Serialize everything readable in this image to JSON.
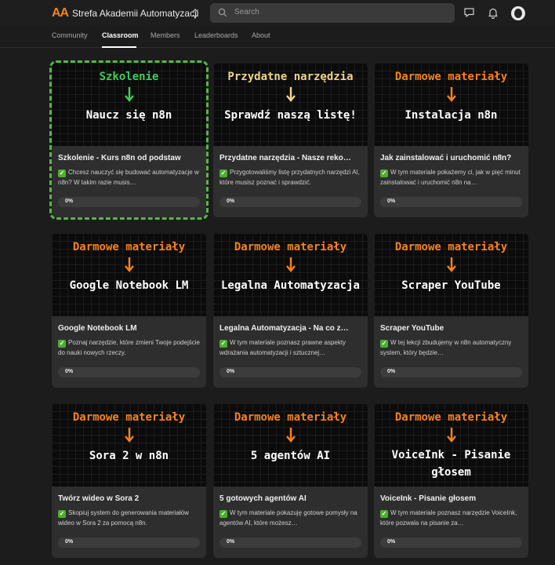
{
  "header": {
    "logo_text": "AA",
    "site_title": "Strefa Akademii Automatyzacji",
    "search_placeholder": "Search"
  },
  "tabs": [
    {
      "label": "Community"
    },
    {
      "label": "Classroom"
    },
    {
      "label": "Members"
    },
    {
      "label": "Leaderboards"
    },
    {
      "label": "About"
    }
  ],
  "colors": {
    "orange": "#f5821f",
    "yellow": "#f1d589",
    "green": "#3fcf55",
    "selected_outline": "#5ab54a"
  },
  "courses": [
    {
      "tag": "Szkolenie",
      "tag_color": "#3fcf55",
      "thumb_text": "Naucz się n8n",
      "title": "Szkolenie - Kurs n8n od podstaw",
      "description": "Chcesz nauczyć się budować automatyzacje w n8n? W takim razie musis…",
      "progress_label": "0%",
      "progress": 0,
      "selected": true
    },
    {
      "tag": "Przydatne narzędzia",
      "tag_color": "#f1d589",
      "thumb_text": "Sprawdź naszą listę!",
      "title": "Przydatne narzędzia - Nasze reko…",
      "description": "Przygotowaliśmy listę przydatnych narzędzi AI, które musisz poznać i sprawdzić.",
      "progress_label": "0%",
      "progress": 0
    },
    {
      "tag": "Darmowe materiały",
      "tag_color": "#f5821f",
      "thumb_text": "Instalacja n8n",
      "title": "Jak zainstalować i uruchomić n8n?",
      "description": "W tym materiale pokażemy ci, jak w pięć minut zainstalować i uruchomić n8n na…",
      "progress_label": "0%",
      "progress": 0
    },
    {
      "tag": "Darmowe materiały",
      "tag_color": "#f5821f",
      "thumb_text": "Google Notebook LM",
      "title": "Google Notebook LM",
      "description": "Poznaj narzędzie, które zmieni Twoje podejście do nauki nowych rzeczy.",
      "progress_label": "0%",
      "progress": 0
    },
    {
      "tag": "Darmowe materiały",
      "tag_color": "#f5821f",
      "thumb_text": "Legalna Automatyzacja",
      "title": "Legalna Automatyzacja - Na co z…",
      "description": "W tym materiale poznasz prawne aspekty wdrażania automatyzacji i sztucznej…",
      "progress_label": "0%",
      "progress": 0
    },
    {
      "tag": "Darmowe materiały",
      "tag_color": "#f5821f",
      "thumb_text": "Scraper YouTube",
      "title": "Scraper YouTube",
      "description": "W tej lekcji zbudujemy w n8n automatyczny system, który będzie…",
      "progress_label": "0%",
      "progress": 0
    },
    {
      "tag": "Darmowe materiały",
      "tag_color": "#f5821f",
      "thumb_text": "Sora 2 w n8n",
      "title": "Twórz wideo w Sora 2",
      "description": "Skopiuj system do generowania materiałów wideo w Sora 2 za pomocą n8n.",
      "progress_label": "0%",
      "progress": 0
    },
    {
      "tag": "Darmowe materiały",
      "tag_color": "#f5821f",
      "thumb_text": "5 agentów AI",
      "title": "5 gotowych agentów AI",
      "description": "W tym materiale pokazuję gotowe pomysły na agentów AI, które możesz…",
      "progress_label": "0%",
      "progress": 0
    },
    {
      "tag": "Darmowe materiały",
      "tag_color": "#f5821f",
      "thumb_text": "VoiceInk - Pisanie głosem",
      "title": "VoiceInk - Pisanie głosem",
      "description": "W tym materiale poznasz narzędzie VoiceInk, które pozwala na pisanie za…",
      "progress_label": "0%",
      "progress": 0
    }
  ]
}
